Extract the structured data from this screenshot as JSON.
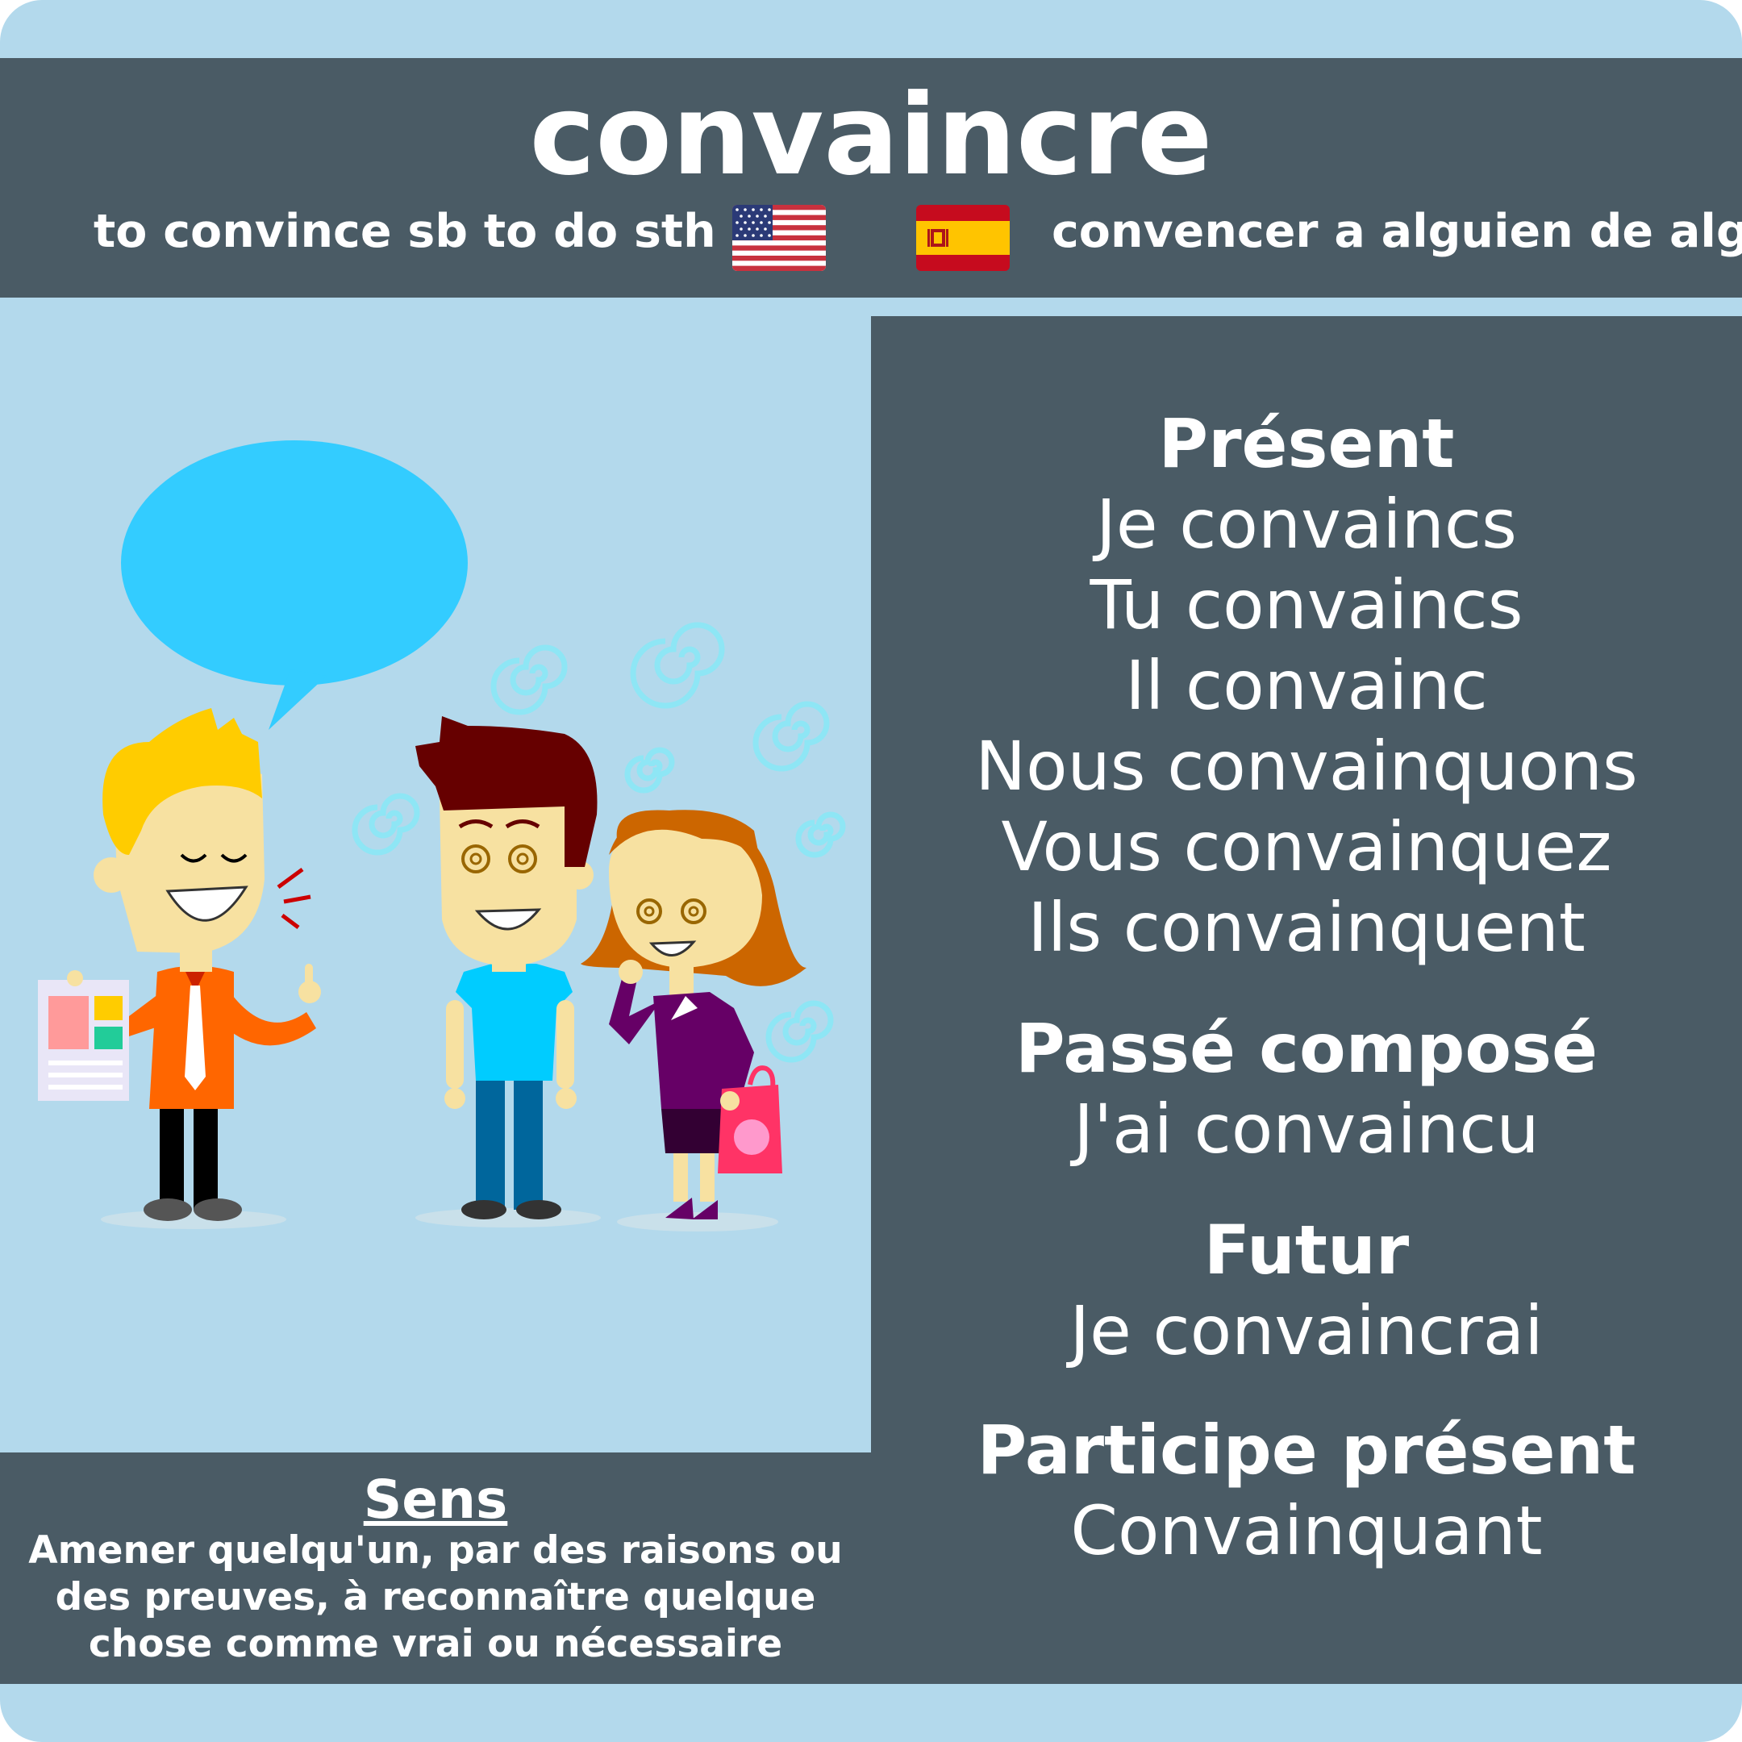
{
  "verb": "convaincre",
  "translations": {
    "english": "to convince sb to do sth",
    "english_flag": "us-flag-icon",
    "spanish_flag": "spain-flag-icon",
    "spanish": "convencer a alguien de algo"
  },
  "conjugations": [
    {
      "tense": "Présent",
      "forms": [
        "Je convaincs",
        "Tu convaincs",
        "Il convainc",
        "Nous convainquons",
        "Vous convainquez",
        "Ils convainquent"
      ]
    },
    {
      "tense": "Passé composé",
      "forms": [
        "J'ai convaincu"
      ]
    },
    {
      "tense": "Futur",
      "forms": [
        "Je convaincrai"
      ]
    },
    {
      "tense": "Participe présent",
      "forms": [
        "Convainquant"
      ]
    }
  ],
  "meaning": {
    "title": "Sens",
    "lines": [
      "Amener quelqu'un, par des raisons ou",
      "des preuves, à reconnaître quelque",
      "chose comme vrai ou nécessaire"
    ]
  },
  "colors": {
    "background": "#b3d9ec",
    "panel": "#4a5b65",
    "text": "#ffffff",
    "speech_bubble": "#33ccff"
  }
}
